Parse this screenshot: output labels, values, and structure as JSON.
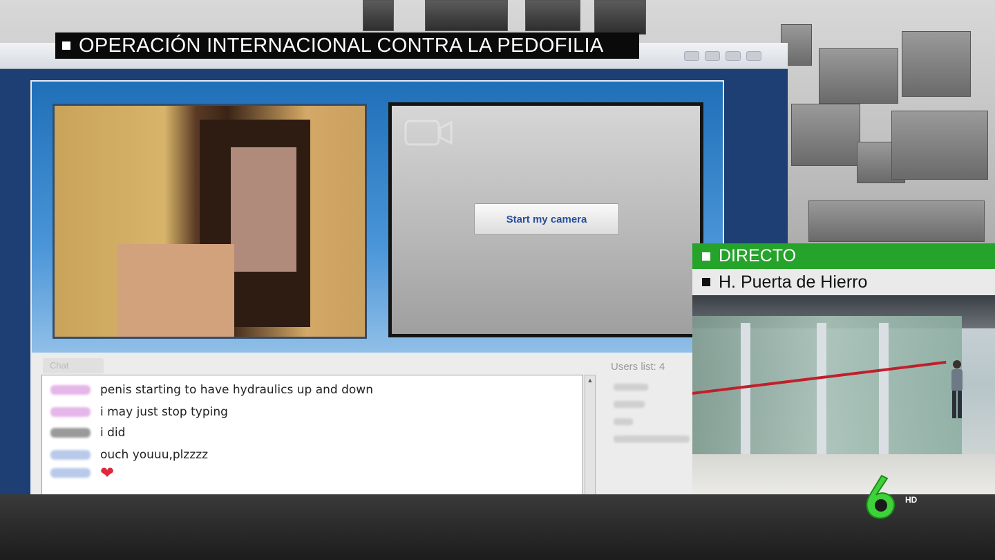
{
  "headline": {
    "text": "OPERACIÓN INTERNACIONAL CONTRA LA PEDOFILIA"
  },
  "live": {
    "label": "DIRECTO",
    "location": "H. Puerta de Hierro"
  },
  "channel": {
    "logo": "laSexta-6-logo",
    "quality": "HD"
  },
  "site": {
    "start_camera_label": "Start my camera",
    "chat_tab_label": "Chat",
    "users_label": "Users list: 4",
    "chat_lines": [
      {
        "nick_color": "pink",
        "text": "penis starting to have hydraulics up and down"
      },
      {
        "nick_color": "pink",
        "text": "i may just stop typing"
      },
      {
        "nick_color": "gray",
        "text": "i did"
      },
      {
        "nick_color": "blue",
        "text": "ouch youuu,plzzzz"
      },
      {
        "nick_color": "blue",
        "text": "",
        "icon": "heart-icon"
      }
    ]
  },
  "colors": {
    "live_green": "#25a32b",
    "banner_black": "#0a0a0a",
    "heart_red": "#e0283b"
  }
}
